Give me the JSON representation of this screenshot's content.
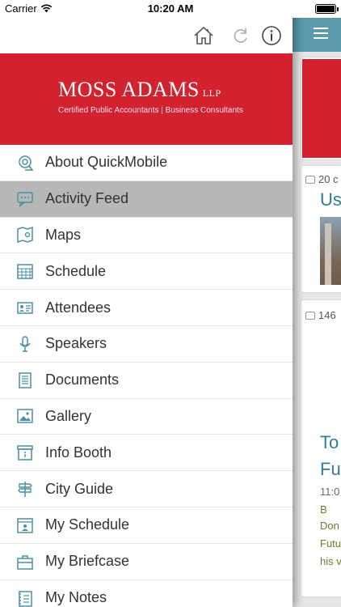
{
  "status": {
    "carrier": "Carrier",
    "time": "10:20 AM"
  },
  "toolbar": {
    "home_icon": "home-icon",
    "refresh_icon": "refresh-icon",
    "info_icon": "info-icon"
  },
  "banner": {
    "logo": "MOSS ADAMS",
    "logo_suffix": "LLP",
    "tagline": "Certified Public Accountants | Business Consultants",
    "color": "#d3222f"
  },
  "menu": {
    "items": [
      {
        "label": "About QuickMobile",
        "icon": "search-icon",
        "active": false
      },
      {
        "label": "Activity Feed",
        "icon": "chat-icon",
        "active": true
      },
      {
        "label": "Maps",
        "icon": "map-icon",
        "active": false
      },
      {
        "label": "Schedule",
        "icon": "calendar-icon",
        "active": false
      },
      {
        "label": "Attendees",
        "icon": "contact-card-icon",
        "active": false
      },
      {
        "label": "Speakers",
        "icon": "microphone-icon",
        "active": false
      },
      {
        "label": "Documents",
        "icon": "document-icon",
        "active": false
      },
      {
        "label": "Gallery",
        "icon": "image-icon",
        "active": false
      },
      {
        "label": "Info Booth",
        "icon": "info-booth-icon",
        "active": false
      },
      {
        "label": "City Guide",
        "icon": "signpost-icon",
        "active": false
      },
      {
        "label": "My Schedule",
        "icon": "my-schedule-icon",
        "active": false
      },
      {
        "label": "My Briefcase",
        "icon": "briefcase-icon",
        "active": false
      },
      {
        "label": "My Notes",
        "icon": "notes-icon",
        "active": false
      }
    ]
  },
  "feed": {
    "header_color": "#5a9aaa",
    "card1_meta": "20 c",
    "card1_title": "Us",
    "card2_meta": "146",
    "card2_title_1": "To",
    "card2_title_2": "Fu",
    "card2_time": "11:0",
    "card2_b": "B",
    "card2_line1": "Don",
    "card2_line2": "Futu",
    "card2_line3": "his v"
  }
}
